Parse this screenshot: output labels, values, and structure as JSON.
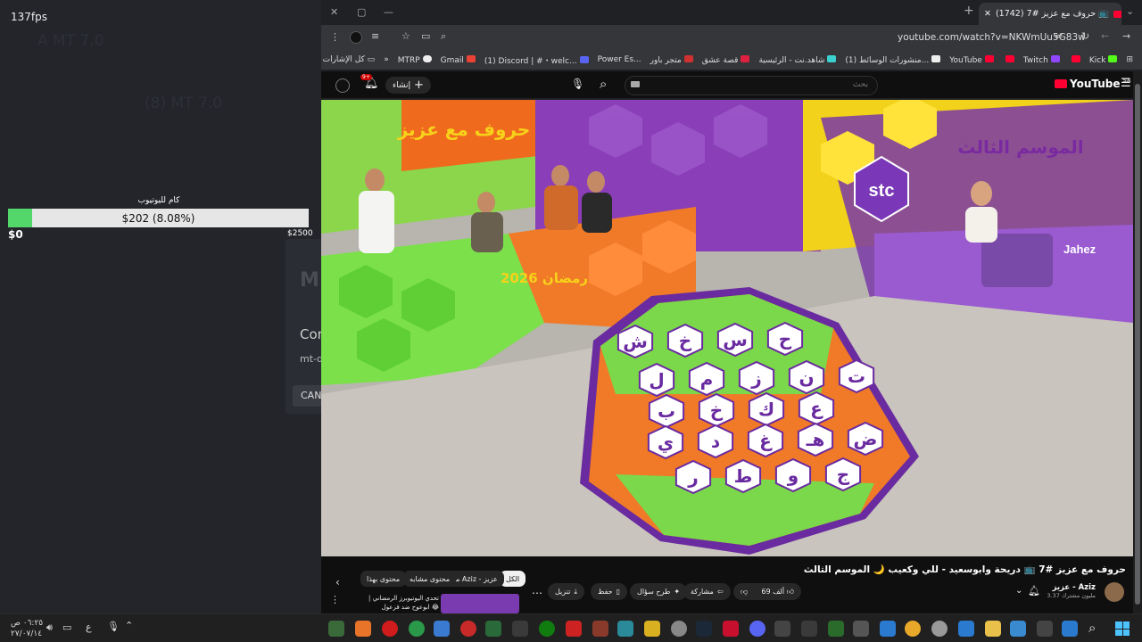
{
  "overlay": {
    "fps": "137fps",
    "ghost_title": "A    MT 7.0",
    "ghost_subtitle": "(8) MT 7.0",
    "goal": {
      "label": "كام لليوتيوب",
      "progress_text": "$202 (8.08%)",
      "progress_fraction": 0.0808,
      "start": "$0",
      "end": "$2500"
    },
    "dialog": {
      "logo": "M",
      "title": "Cor",
      "url": "mt-q",
      "button": "CAN"
    }
  },
  "browser": {
    "tab_title": "(1742) حروف مع عزيز #7 📺",
    "url": "youtube.com/watch?v=NKWmUu5G83w",
    "bookmarks": [
      {
        "label": "Kick",
        "color": "#53fc18"
      },
      {
        "label": "",
        "color": "#ff0033"
      },
      {
        "label": "Twitch",
        "color": "#9146ff"
      },
      {
        "label": "YouTube",
        "color": "#ff0033"
      },
      {
        "label": "(1) منشورات الوسائط...",
        "color": "#eeeeee"
      },
      {
        "label": "شاهد.نت - الرئيسية",
        "color": "#3ccfcf"
      },
      {
        "label": "قصة عشق",
        "color": "#e02040"
      },
      {
        "label": "متجر باور",
        "color": "#d03030"
      },
      {
        "label": "Power Es...",
        "color": "#ff9900"
      },
      {
        "label": "(1) Discord | #・welc...",
        "color": "#5865f2"
      },
      {
        "label": "Gmail",
        "color": "#ea4335"
      },
      {
        "label": "MTRP",
        "color": "#eeeeee"
      }
    ],
    "bookmarks_overflow": "»",
    "all_bookmarks": "كل الإشارات المرجعية"
  },
  "youtube": {
    "logo": "YouTube",
    "logo_region": "SA",
    "search_placeholder": "بحث",
    "create_label": "إنشاء",
    "notifications_badge": "9+",
    "video_title": "حروف مع عزيز #7 📺 دريحة وابوسعيد - للي وكعيب 🌙 الموسم الثالث",
    "channel_name": "عزيز - Aziz",
    "subscribers": "3.37 مليون مشترك",
    "likes": "69 ألف",
    "actions": {
      "share": "مشاركة",
      "ask": "طرح سؤال",
      "save": "حفظ",
      "download": "تنزيل"
    },
    "chips": [
      "الكل",
      "من Aziz - عزيز",
      "محتوى مشابه",
      "محتوى بهذا"
    ],
    "related_title": "تحدي اليوتيوبرز الرمضاني | ابوعوح ضد فزعول 😂",
    "scene": {
      "season_text": "الموسم الثالث",
      "show_logo": "حروف مع عزيز",
      "ramadan_text": "رمضان 2026",
      "sponsor_stc": "stc",
      "sponsor_jahez": "Jahez",
      "hex_letters": [
        [
          "ح",
          "س",
          "خ",
          "ش"
        ],
        [
          "ت",
          "ن",
          "ز",
          "م",
          "ل"
        ],
        [
          "ع",
          "ك",
          "خ",
          "ب"
        ],
        [
          "ض",
          "هـ",
          "غ",
          "د",
          "ي"
        ],
        [
          "ج",
          "و",
          "ط",
          "ر"
        ]
      ]
    }
  },
  "taskbar": {
    "time": "٠٦:٢٥ ص",
    "date": "٢٧/٠٧/١٤",
    "lang": "ع"
  }
}
